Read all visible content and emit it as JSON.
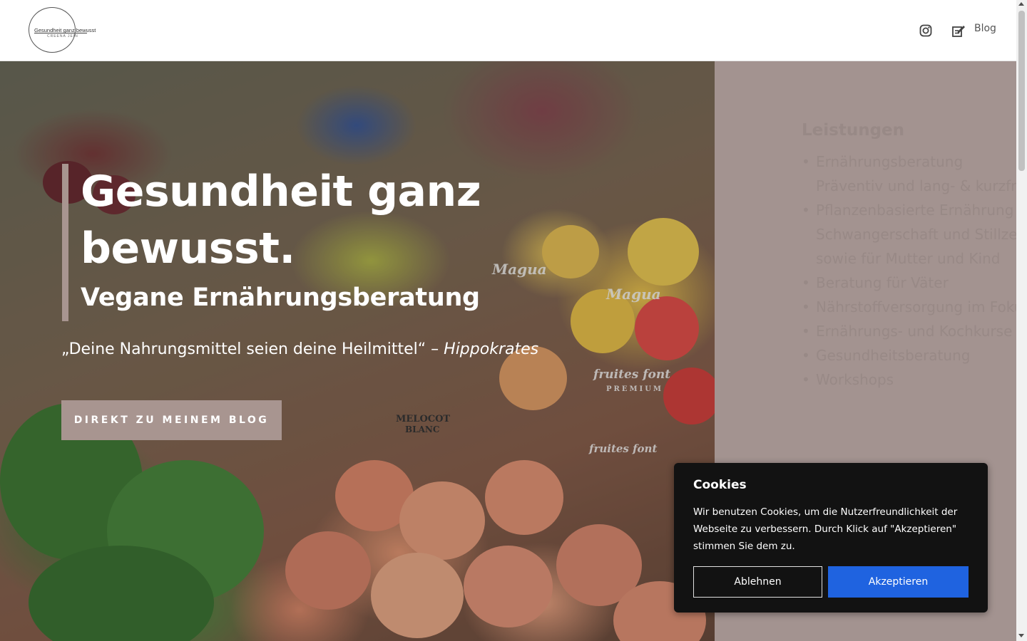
{
  "header": {
    "logo_text": "Gesundheit ganz bewusst",
    "logo_subtext": "CREENA JEIN",
    "nav": {
      "instagram_icon": "instagram-icon",
      "blog_icon": "edit-note-icon",
      "blog_label": "Blog"
    }
  },
  "hero": {
    "title": "Gesundheit ganz bewusst.",
    "subtitle": "Vegane Ernährungsberatung",
    "quote_text": "„Deine Nahrungsmittel seien deine Heilmittel“ – ",
    "quote_author": "Hippokrates",
    "cta_label": "DIREKT ZU MEINEM BLOG",
    "image_labels": {
      "box1": "Magua",
      "box2": "Magua",
      "box3": "fruites font",
      "box3_sub": "PREMIUM",
      "box4": "fruites font",
      "sign1": "MELOCOT",
      "sign2": "BLANC"
    }
  },
  "side_panel": {
    "title": "Leistungen",
    "items": [
      "Ernährungsberatung",
      "Präventiv und lang- & kurzfristig",
      "Pflanzenbasierte Ernährung in der",
      "Schwangerschaft und Stillzeit",
      "sowie für Mutter und Kind",
      "Beratung für Väter",
      "Nährstoffversorgung im Fokus",
      "Ernährungs- und Kochkurse",
      "Gesundheitsberatung",
      "Workshops"
    ]
  },
  "cookie_banner": {
    "title": "Cookies",
    "text": "Wir benutzen Cookies, um die Nutzerfreundlichkeit der Webseite zu verbessern. Durch Klick auf \"Akzeptieren\" stimmen Sie dem zu.",
    "decline_label": "Ablehnen",
    "accept_label": "Akzeptieren"
  },
  "colors": {
    "accent": "#a89590",
    "side_panel_bg": "#a39390",
    "accept_button": "#1f63e0",
    "cookie_bg": "#121212"
  }
}
